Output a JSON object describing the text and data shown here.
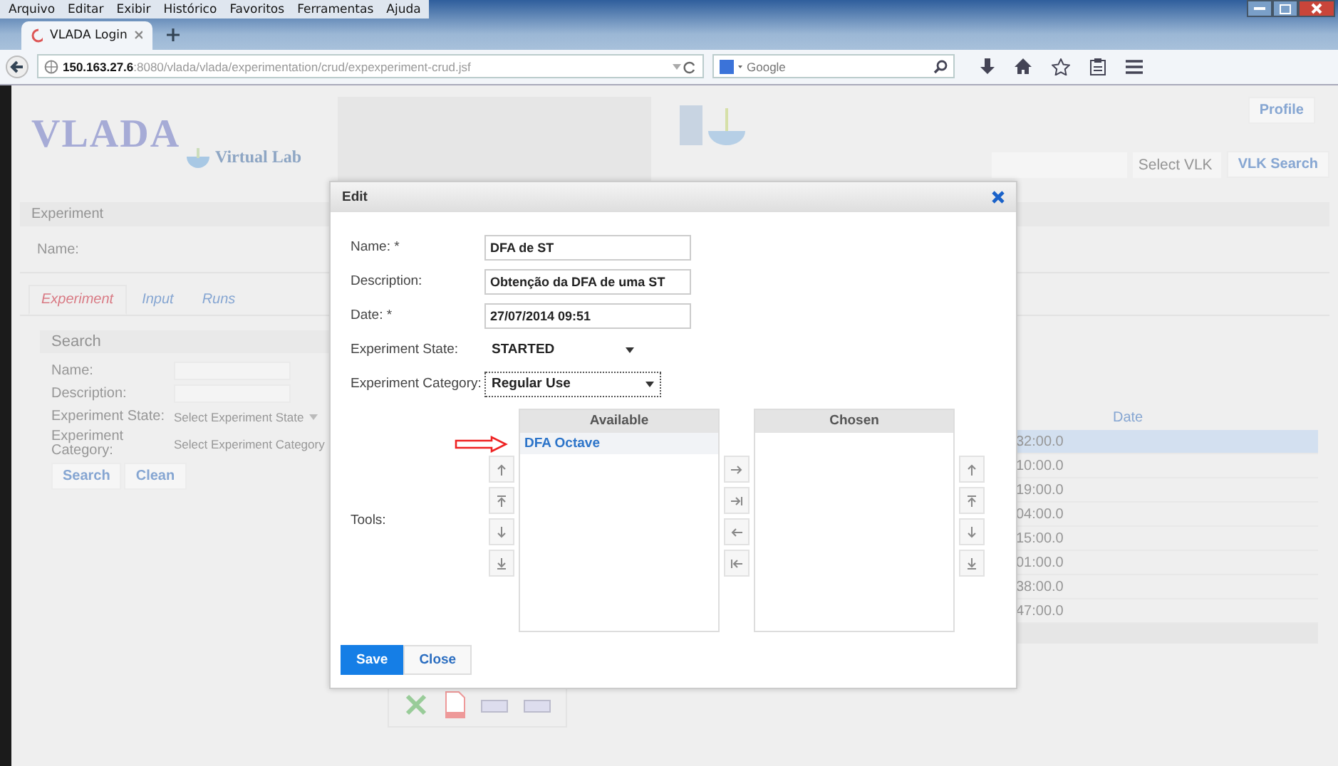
{
  "browser": {
    "menu": [
      "Arquivo",
      "Editar",
      "Exibir",
      "Histórico",
      "Favoritos",
      "Ferramentas",
      "Ajuda"
    ],
    "tab": {
      "title": "VLADA Login"
    },
    "address": {
      "host": "150.163.27.6",
      "path": ":8080/vlada/vlada/experimentation/crud/expexperiment-crud.jsf"
    },
    "search": {
      "placeholder": "Google"
    }
  },
  "page": {
    "logo": "VLADA",
    "subtitle": "Virtual Lab",
    "profile": "Profile",
    "vlk_select": "Select VLK",
    "vlk_search": "VLK Search",
    "section": "Experiment",
    "name_label": "Name:",
    "tabs": [
      {
        "label": "Experiment",
        "selected": true
      },
      {
        "label": "Input",
        "selected": false
      },
      {
        "label": "Runs",
        "selected": false
      }
    ],
    "search_panel": {
      "title": "Search",
      "fields": [
        {
          "label": "Name:",
          "kind": "text"
        },
        {
          "label": "Description:",
          "kind": "text"
        },
        {
          "label": "Experiment State:",
          "kind": "select",
          "placeholder": "Select Experiment State"
        },
        {
          "label": "Experiment Category:",
          "kind": "select",
          "placeholder": "Select Experiment Category"
        }
      ],
      "buttons": [
        "Search",
        "Clean"
      ]
    },
    "table": {
      "column": "Date",
      "rows": [
        {
          "date": "32:00.0",
          "selected": true
        },
        {
          "date": "10:00.0",
          "selected": false
        },
        {
          "date": "19:00.0",
          "selected": false
        },
        {
          "date": "04:00.0",
          "selected": false
        },
        {
          "date": "15:00.0",
          "selected": false
        },
        {
          "date": "01:00.0",
          "selected": false
        },
        {
          "date": "38:00.0",
          "selected": false
        },
        {
          "date": "47:00.0",
          "selected": false
        }
      ]
    }
  },
  "dialog": {
    "title": "Edit",
    "fields": [
      {
        "label": "Name: *",
        "kind": "text",
        "value": "DFA de ST",
        "focused": false
      },
      {
        "label": "Description:",
        "kind": "text",
        "value": "Obtenção da DFA de uma ST",
        "focused": false
      },
      {
        "label": "Date: *",
        "kind": "text",
        "value": "27/07/2014 09:51",
        "focused": false
      },
      {
        "label": "Experiment State:",
        "kind": "select",
        "value": "STARTED",
        "focused": false
      },
      {
        "label": "Experiment Category:",
        "kind": "select",
        "value": "Regular Use",
        "focused": true
      }
    ],
    "tools": {
      "label": "Tools:",
      "available": {
        "title": "Available",
        "items": [
          {
            "label": "DFA Octave",
            "selected": true
          }
        ]
      },
      "chosen": {
        "title": "Chosen"
      }
    },
    "buttons": [
      {
        "label": "Save",
        "kind": "primary"
      },
      {
        "label": "Close",
        "kind": "secondary"
      }
    ]
  }
}
